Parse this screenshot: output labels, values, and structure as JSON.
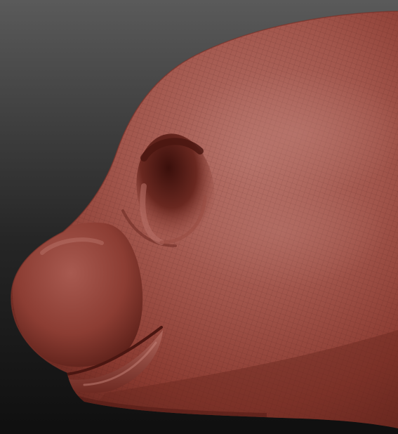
{
  "scene": {
    "subject": "sculpted-animal-head-side-profile",
    "colors": {
      "background_top": "#5a5a5a",
      "background_bottom": "#0f0f0f",
      "clay_light": "#b06a62",
      "clay_mid": "#8e3d33",
      "clay_dark": "#5a1f19",
      "wire": "#3a120e"
    }
  }
}
